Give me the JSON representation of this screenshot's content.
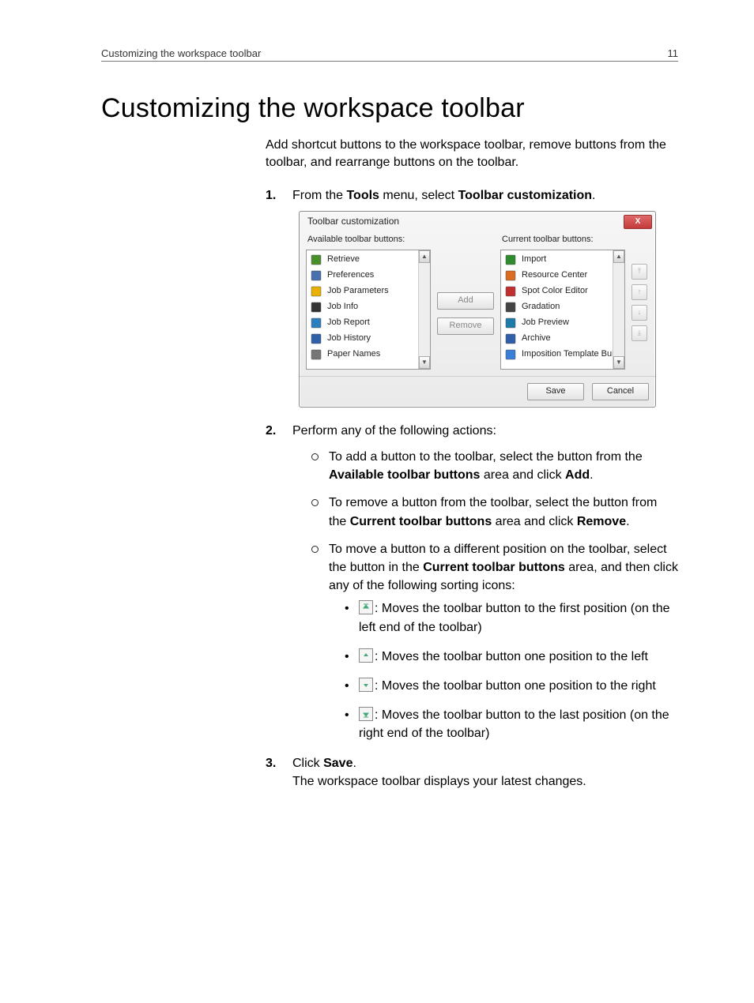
{
  "header": {
    "left": "Customizing the workspace toolbar",
    "right": "11"
  },
  "title": "Customizing the workspace toolbar",
  "intro": "Add shortcut buttons to the workspace toolbar, remove buttons from the toolbar, and rearrange buttons on the toolbar.",
  "step1": {
    "pre": "From the ",
    "bold1": "Tools",
    "mid": " menu, select ",
    "bold2": "Toolbar customization",
    "post": "."
  },
  "dialog": {
    "title": "Toolbar customization",
    "close": "X",
    "available_label": "Available toolbar buttons:",
    "current_label": "Current toolbar buttons:",
    "add": "Add",
    "remove": "Remove",
    "save": "Save",
    "cancel": "Cancel",
    "available": [
      {
        "label": "Retrieve",
        "color": "#4a8f2a"
      },
      {
        "label": "Preferences",
        "color": "#4a6fae"
      },
      {
        "label": "Job Parameters",
        "color": "#e8b000"
      },
      {
        "label": "Job Info",
        "color": "#333"
      },
      {
        "label": "Job Report",
        "color": "#2b7fbf"
      },
      {
        "label": "Job History",
        "color": "#2f5fa8"
      },
      {
        "label": "Paper Names",
        "color": "#777"
      }
    ],
    "current": [
      {
        "label": "Import",
        "color": "#2e8b2e"
      },
      {
        "label": "Resource Center",
        "color": "#d96c1e"
      },
      {
        "label": "Spot Color Editor",
        "color": "#c03030"
      },
      {
        "label": "Gradation",
        "color": "#444"
      },
      {
        "label": "Job Preview",
        "color": "#1e7aa8"
      },
      {
        "label": "Archive",
        "color": "#2f5fa8"
      },
      {
        "label": "Imposition Template Builder",
        "color": "#3a7fd6"
      }
    ]
  },
  "step2": {
    "intro": "Perform any of the following actions:",
    "a": {
      "pre": "To add a button to the toolbar, select the button from the ",
      "bold1": "Available toolbar buttons",
      "mid": " area and click ",
      "bold2": "Add",
      "post": "."
    },
    "b": {
      "pre": "To remove a button from the toolbar, select the button from the ",
      "bold1": "Current toolbar buttons",
      "mid": " area and click ",
      "bold2": "Remove",
      "post": "."
    },
    "c": {
      "pre": "To move a button to a different position on the toolbar, select the button in the ",
      "bold1": "Current toolbar buttons",
      "post": " area, and then click any of the following sorting icons:"
    },
    "icons": {
      "first": ": Moves the toolbar button to the first position (on the left end of the toolbar)",
      "left": ": Moves the toolbar button one position to the left",
      "right": ": Moves the toolbar button one position to the right",
      "last": ": Moves the toolbar button to the last position (on the right end of the toolbar)"
    }
  },
  "step3": {
    "pre": "Click ",
    "bold": "Save",
    "post": ".",
    "result": "The workspace toolbar displays your latest changes."
  }
}
